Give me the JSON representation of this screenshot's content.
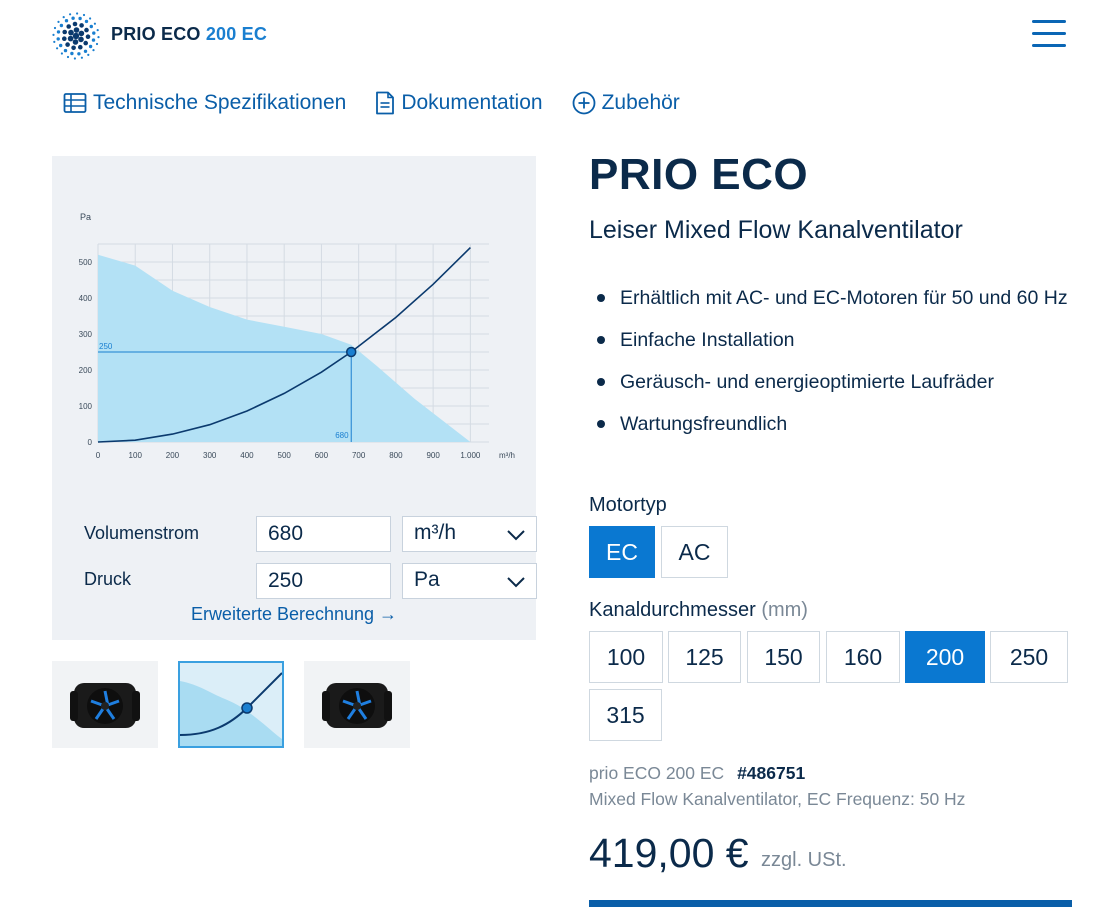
{
  "header": {
    "logo_name": "PRIO ECO",
    "logo_model": "200 EC",
    "menu_icon": "hamburger-menu-icon"
  },
  "tabs": [
    {
      "label": "Technische Spezifikationen",
      "icon": "table-icon"
    },
    {
      "label": "Dokumentation",
      "icon": "document-icon"
    },
    {
      "label": "Zubehör",
      "icon": "plus-circle-icon"
    }
  ],
  "product": {
    "title": "PRIO ECO",
    "subtitle": "Leiser Mixed Flow Kanalventilator",
    "features": [
      "Erhältlich mit AC- und EC-Motoren für 50 und 60 Hz",
      "Einfache Installation",
      "Geräusch- und energieoptimierte Laufräder",
      "Wartungsfreundlich"
    ],
    "motortyp": {
      "label": "Motortyp",
      "options": [
        "EC",
        "AC"
      ],
      "selected": "EC"
    },
    "diameter": {
      "label": "Kanaldurchmesser",
      "unit": "(mm)",
      "options": [
        "100",
        "125",
        "150",
        "160",
        "200",
        "250",
        "315"
      ],
      "selected": "200"
    },
    "sku_name": "prio ECO 200 EC",
    "sku_number": "#486751",
    "description": "Mixed Flow Kanalventilator, EC  Frequenz: 50 Hz",
    "price": "419,00 €",
    "price_note": "zzgl. USt."
  },
  "calculator": {
    "flow_label": "Volumenstrom",
    "flow_value": "680",
    "flow_unit": "m³/h",
    "pressure_label": "Druck",
    "pressure_value": "250",
    "pressure_unit": "Pa",
    "advanced_link": "Erweiterte Berechnung →"
  },
  "thumbnails": [
    {
      "label": "fan-product-image",
      "active": false
    },
    {
      "label": "chart-thumbnail",
      "active": true
    },
    {
      "label": "fan-product-image",
      "active": false
    }
  ],
  "chart_data": {
    "type": "area",
    "ylabel": "Pa",
    "xlabel": "m³/h",
    "x_ticks": [
      "0",
      "100",
      "200",
      "300",
      "400",
      "500",
      "600",
      "700",
      "800",
      "900",
      "1.000"
    ],
    "y_ticks": [
      "0",
      "100",
      "200",
      "300",
      "400",
      "500"
    ],
    "xlim": [
      0,
      1050
    ],
    "ylim": [
      0,
      550
    ],
    "series": [
      {
        "type": "area",
        "x": [
          0,
          100,
          200,
          300,
          400,
          500,
          600,
          680,
          750,
          850,
          950,
          1000
        ],
        "y": [
          520,
          490,
          420,
          375,
          340,
          320,
          300,
          270,
          210,
          120,
          40,
          0
        ]
      },
      {
        "type": "line",
        "x": [
          0,
          100,
          200,
          300,
          400,
          500,
          600,
          680,
          800,
          900,
          1000
        ],
        "y": [
          0,
          5,
          22,
          48,
          86,
          135,
          194,
          250,
          346,
          438,
          540
        ]
      }
    ],
    "operating_point": {
      "x": 680,
      "y": 250,
      "x_label": "680",
      "y_label": "250"
    },
    "colors": {
      "area": "#b3e1f5",
      "curve": "#0b3a6e",
      "marker": "#1a7fd0"
    }
  }
}
